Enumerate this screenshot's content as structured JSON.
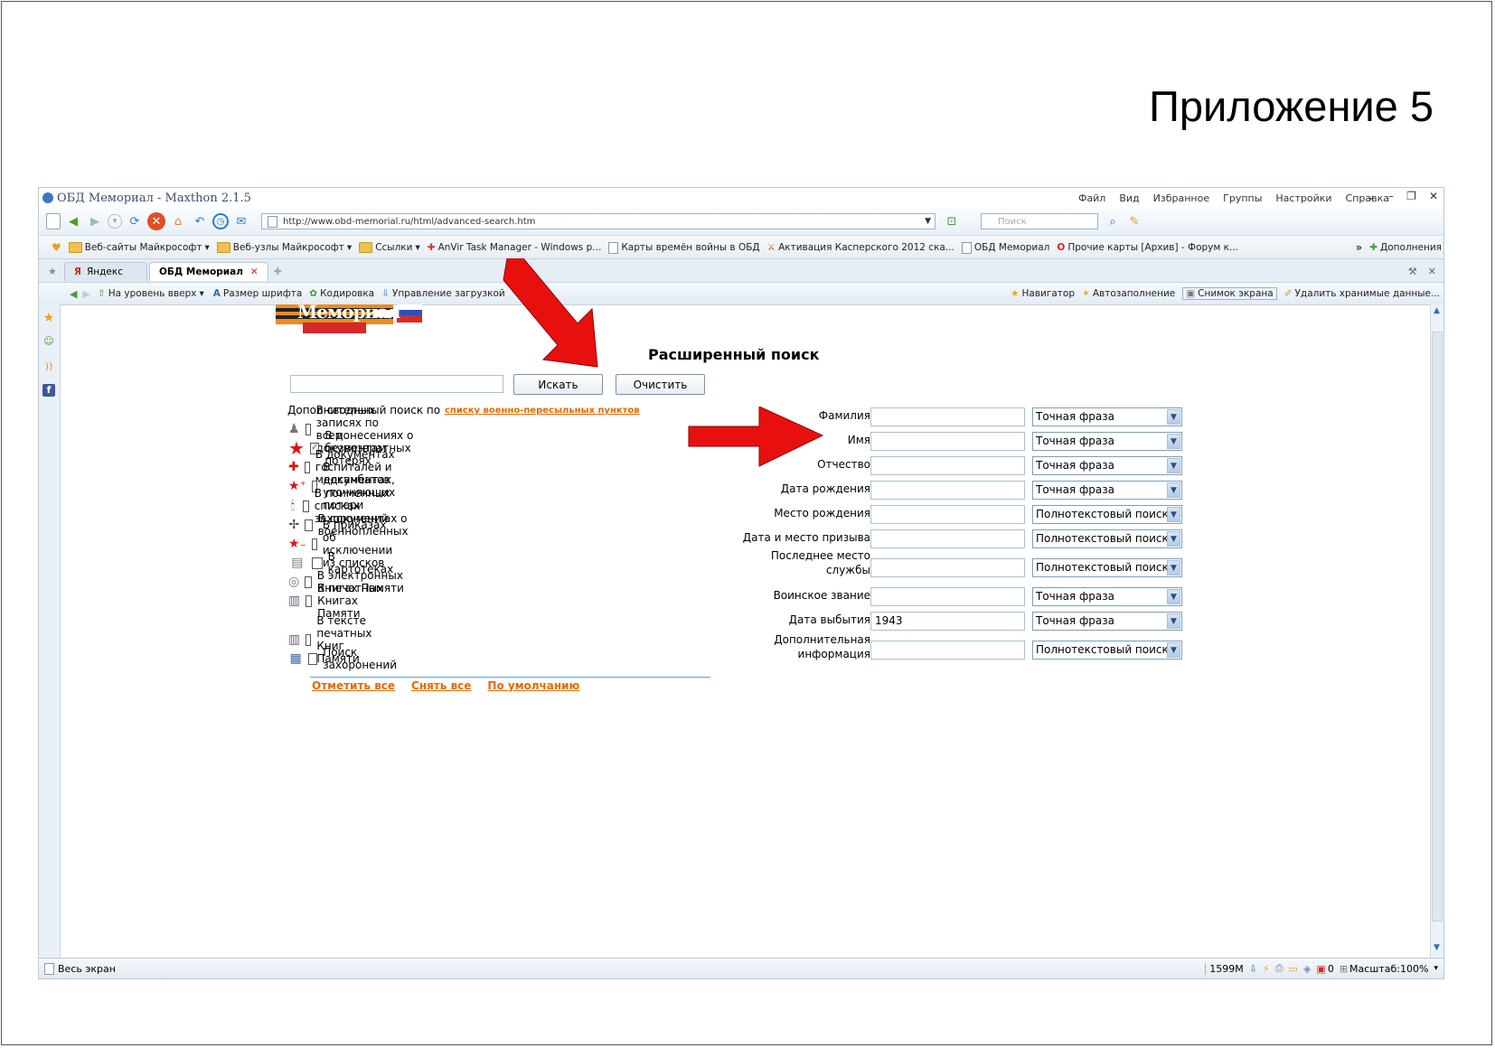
{
  "slide": {
    "title": "Приложение 5"
  },
  "browser": {
    "window_title": "ОБД Мемориал - Maxthon 2.1.5",
    "menu": [
      "Файл",
      "Вид",
      "Избранное",
      "Группы",
      "Настройки",
      "Справка"
    ],
    "address": "http://www.obd-memorial.ru/html/advanced-search.htm",
    "search_placeholder": "Поиск",
    "bookmarks": [
      "Веб-сайты Майкрософт",
      "Веб-узлы Майкрософт",
      "Ссылки",
      "AnVir Task Manager - Windows р...",
      "Карты времён войны в ОБД",
      "Активация Касперского 2012 ска...",
      "ОБД Мемориал",
      "Прочие карты [Архив] - Форум к..."
    ],
    "addons_label": "Дополнения",
    "tabs": [
      "Яндекс",
      "ОБД Мемориал"
    ],
    "subbar_left": [
      "На уровень вверх",
      "Размер шрифта",
      "Кодировка",
      "Управление загрузкой"
    ],
    "subbar_right": [
      "Навигатор",
      "Автозаполнение",
      "Снимок экрана",
      "Удалить хранимые данные..."
    ],
    "status": {
      "left": "Весь экран",
      "memory": "1599M",
      "count": "0",
      "zoom": "Масштаб:100%"
    }
  },
  "page": {
    "logo_text": "Мемориал",
    "heading": "Расширенный поиск",
    "search_button": "Искать",
    "clear_button": "Очистить",
    "additional_label": "Дополнительный поиск по",
    "additional_link": "списку военно-пересыльных пунктов",
    "sources": [
      {
        "label": "В сводных записях по всем документам",
        "checked": false,
        "icon": "person-icon"
      },
      {
        "label": "В донесениях о безвозвратных потерях",
        "checked": true,
        "icon": "red-star-icon"
      },
      {
        "label": "В документах госпиталей и медсанбатов",
        "checked": false,
        "icon": "red-cross-icon"
      },
      {
        "label": "В документах, уточняющих потери",
        "checked": false,
        "icon": "star-plus-icon"
      },
      {
        "label": "В поименных списках захоронений",
        "checked": false,
        "icon": "candle-icon"
      },
      {
        "label": "В документах о военнопленных",
        "checked": false,
        "icon": "barbed-wire-icon"
      },
      {
        "label": "В приказах об исключении из списков",
        "checked": false,
        "icon": "star-minus-icon"
      },
      {
        "label": "В картотеках",
        "checked": false,
        "icon": "card-index-icon"
      },
      {
        "label": "В электронных Книгах Памяти",
        "checked": false,
        "icon": "cd-book-icon"
      },
      {
        "label": "В печатных Книгах Памяти",
        "checked": false,
        "icon": "printed-book-icon"
      },
      {
        "label": "В тексте печатных Книг Памяти",
        "checked": false,
        "icon": "book-text-icon"
      },
      {
        "label": "Поиск захоронений",
        "checked": false,
        "icon": "burial-icon"
      }
    ],
    "actions": [
      "Отметить все",
      "Снять все",
      "По умолчанию"
    ],
    "fields": [
      {
        "label": "Фамилия",
        "value": "",
        "mode": "Точная фраза"
      },
      {
        "label": "Имя",
        "value": "",
        "mode": "Точная фраза"
      },
      {
        "label": "Отчество",
        "value": "",
        "mode": "Точная фраза"
      },
      {
        "label": "Дата рождения",
        "value": "",
        "mode": "Точная фраза"
      },
      {
        "label": "Место рождения",
        "value": "",
        "mode": "Полнотекстовый поиск"
      },
      {
        "label": "Дата и место призыва",
        "value": "",
        "mode": "Полнотекстовый поиск"
      },
      {
        "label": "Последнее место службы",
        "value": "",
        "mode": "Полнотекстовый поиск"
      },
      {
        "label": "Воинское звание",
        "value": "",
        "mode": "Точная фраза"
      },
      {
        "label": "Дата выбытия",
        "value": "1943",
        "mode": "Точная фраза"
      },
      {
        "label": "Дополнительная информация",
        "value": "",
        "mode": "Полнотекстовый поиск"
      }
    ]
  },
  "colors": {
    "annotation_arrow": "#e8100f",
    "link_orange": "#e56a00",
    "accent_blue": "#5da5c9"
  }
}
